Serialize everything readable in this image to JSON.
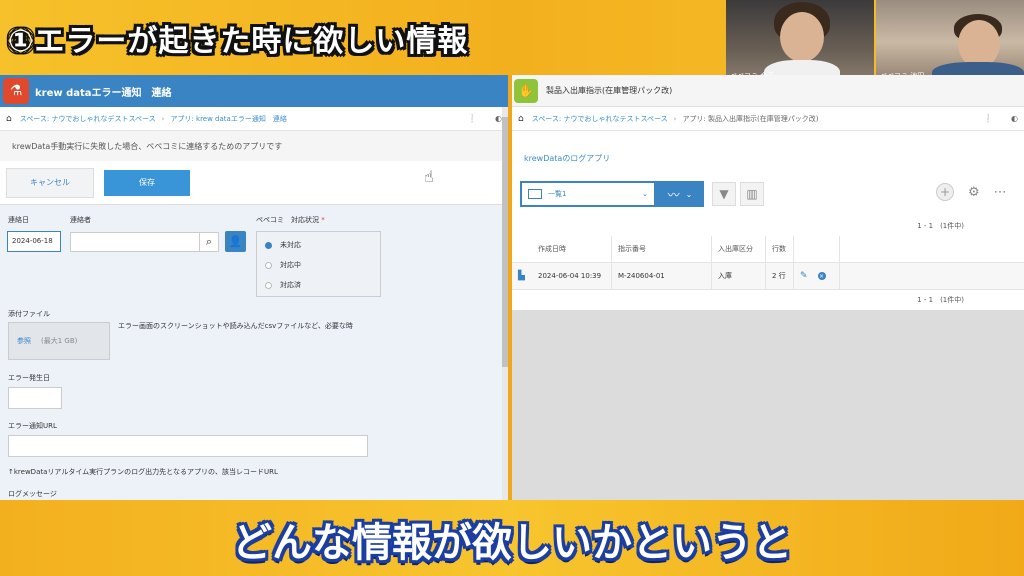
{
  "overlay": {
    "top_title": "①エラーが起きた時に欲しい情報",
    "subtitle": "どんな情報が欲しいかというと"
  },
  "left_window": {
    "app_title": "krew dataエラー通知　連絡",
    "breadcrumb": {
      "space": "スペース: ナウでおしゃれなデストスペース",
      "app": "アプリ: krew dataエラー通知　連絡"
    },
    "description": "krewData手動実行に失敗した場合、ペペコミに連絡するためのアプリです",
    "buttons": {
      "cancel": "キャンセル",
      "save": "保存"
    },
    "form": {
      "contact_date_label": "連絡日",
      "contact_date_value": "2024-06-18",
      "contact_person_label": "連絡者",
      "status_label": "ペペコミ　対応状況",
      "required_mark": "*",
      "status_options": [
        "未対応",
        "対応中",
        "対応済"
      ],
      "status_selected": "未対応",
      "attachment_label": "添付ファイル",
      "attachment_browse": "参照",
      "attachment_max": "(最大1 GB)",
      "attachment_hint": "エラー画面のスクリーンショットや読み込んだcsvファイルなど、必要な時",
      "error_date_label": "エラー発生日",
      "error_url_label": "エラー通知URL",
      "url_hint": "↑krewDataリアルタイム実行プランのログ出力先となるアプリの、該当レコードURL",
      "log_message_label": "ログメッセージ"
    }
  },
  "right_window": {
    "app_title": "製品入出庫指示(在庫管理パック改)",
    "breadcrumb": {
      "space": "スペース: ナウでおしゃれなテストスペース",
      "app": "アプリ: 製品入出庫指示(在庫管理パック改)"
    },
    "link": "krewDataのログアプリ",
    "view_name": "一覧1",
    "pager_top": "1 - 1　(1件中)",
    "pager_bottom": "1 - 1　(1件中)",
    "table": {
      "headers": [
        "作成日時",
        "指示番号",
        "入出庫区分",
        "行数"
      ],
      "rows": [
        {
          "created": "2024-06-04 10:39",
          "instruction_no": "M-240604-01",
          "type": "入庫",
          "lines": "2 行"
        }
      ]
    }
  },
  "webcams": {
    "left_name": "ペペコミ 金子",
    "right_name": "ペペコミ 池田"
  }
}
